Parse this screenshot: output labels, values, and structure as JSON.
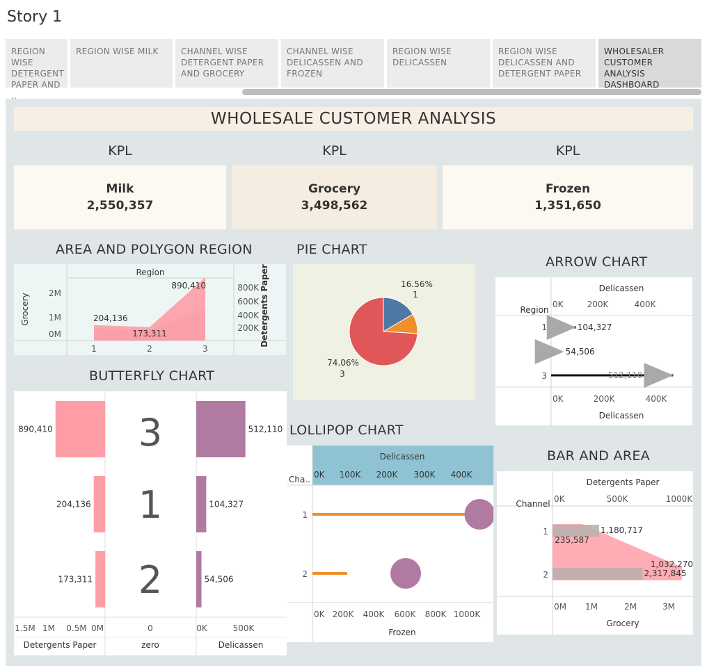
{
  "story": {
    "title": "Story 1"
  },
  "tabs": [
    {
      "label": "REGION WISE DETERGENT PAPER AND .."
    },
    {
      "label": "REGION WISE MILK"
    },
    {
      "label": "CHANNEL WISE DETERGENT PAPER AND GROCERY"
    },
    {
      "label": "CHANNEL WISE DELICASSEN AND FROZEN"
    },
    {
      "label": "REGION WISE DELICASSEN"
    },
    {
      "label": "REGION WISE DELICASSEN AND DETERGENT PAPER"
    },
    {
      "label": "WHOLESALER CUSTOMER ANALYSIS DASHBOARD"
    }
  ],
  "dashboard": {
    "title": "WHOLESALE CUSTOMER ANALYSIS",
    "kpis": [
      {
        "header": "KPL",
        "name": "Milk",
        "value": "2,550,357",
        "bg": "#fdf9f1"
      },
      {
        "header": "KPL",
        "name": "Grocery",
        "value": "3,498,562",
        "bg": "#f5ede2"
      },
      {
        "header": "KPL",
        "name": "Frozen",
        "value": "1,351,650",
        "bg": "#fdf9f1"
      }
    ],
    "section_titles": {
      "area": "AREA AND POLYGON REGION",
      "pie": "PIE CHART",
      "arrow": "ARROW CHART",
      "butterfly": "BUTTERFLY CHART",
      "lollipop": "LOLLIPOP CHART",
      "bar_area": "BAR AND AREA"
    }
  },
  "colors": {
    "pink": "#ff9da7",
    "gray_fill": "#bab0ac",
    "purple": "#b07aa1",
    "orange": "#f28e2b",
    "blue": "#4e79a7",
    "red": "#e15759",
    "gray_arrow": "#a9a9a9"
  },
  "chart_data": [
    {
      "id": "area",
      "type": "area",
      "header": "Region",
      "categories": [
        "1",
        "2",
        "3"
      ],
      "series": [
        {
          "name": "Grocery",
          "values": [
            204136,
            173311,
            890410
          ]
        },
        {
          "name": "Detergents Paper",
          "values": [
            204136,
            173311,
            890410
          ]
        }
      ],
      "data_labels": [
        "204,136",
        "173,311",
        "890,410"
      ],
      "ylabel_left": "Grocery",
      "yticks_left": [
        "2M",
        "1M",
        "0M"
      ],
      "ylabel_right": "Detergents Paper",
      "yticks_right": [
        "800K",
        "600K",
        "400K",
        "200K"
      ]
    },
    {
      "id": "pie",
      "type": "pie",
      "slices": [
        {
          "region": "3",
          "pct": 74.06,
          "color": "#e15759",
          "label": "74.06%",
          "sub": "3"
        },
        {
          "region": "1",
          "pct": 16.56,
          "color": "#4e79a7",
          "label": "16.56%",
          "sub": "1"
        },
        {
          "region": "2",
          "pct": 9.38,
          "color": "#f28e2b"
        }
      ]
    },
    {
      "id": "arrow",
      "type": "bar",
      "header": "Delicassen",
      "row_header": "Region",
      "categories": [
        "1",
        "2",
        "3"
      ],
      "values": [
        104327,
        54506,
        512110
      ],
      "data_labels": [
        "104,327",
        "54,506",
        "512,110"
      ],
      "xticks": [
        "0K",
        "200K",
        "400K"
      ],
      "xlim": [
        0,
        550000
      ],
      "xlabel": "Delicassen"
    },
    {
      "id": "butterfly",
      "type": "bar",
      "categories": [
        "3",
        "1",
        "2"
      ],
      "left_values": [
        890410,
        204136,
        173311
      ],
      "left_labels": [
        "890,410",
        "204,136",
        "173,311"
      ],
      "right_values": [
        512110,
        104327,
        54506
      ],
      "right_labels": [
        "512,110",
        "104,327",
        "54,506"
      ],
      "left_ticks": [
        "1.5M",
        "1M",
        "0.5M",
        "0M"
      ],
      "mid_tick": "0",
      "right_ticks": [
        "0K",
        "500K"
      ],
      "left_axis": "Detergents Paper",
      "mid_axis": "zero",
      "right_axis": "Delicassen"
    },
    {
      "id": "lollipop",
      "type": "scatter",
      "header": "Delicassen",
      "row_header": "Cha..",
      "top_ticks": [
        "0K",
        "100K",
        "200K",
        "300K",
        "400K"
      ],
      "bottom_ticks": [
        "0K",
        "200K",
        "400K",
        "600K",
        "800K",
        "1000K"
      ],
      "xlabel": "Frozen",
      "categories": [
        "1",
        "2"
      ],
      "frozen": [
        1028000,
        226000
      ],
      "delicassen": [
        420000,
        248000
      ]
    },
    {
      "id": "bar_area",
      "type": "bar",
      "header": "Detergents Paper",
      "row_header": "Channel",
      "top_ticks": [
        "0K",
        "500K",
        "1000K"
      ],
      "bottom_ticks": [
        "0M",
        "1M",
        "2M",
        "3M"
      ],
      "xlabel": "Grocery",
      "categories": [
        "1",
        "2"
      ],
      "detergents_paper": [
        235587,
        1032270
      ],
      "grocery": [
        1180717,
        2317845
      ],
      "labels_grocery": [
        "1,180,717",
        "2,317,845"
      ],
      "labels_detergents": [
        "235,587",
        "1,032,270"
      ]
    }
  ]
}
